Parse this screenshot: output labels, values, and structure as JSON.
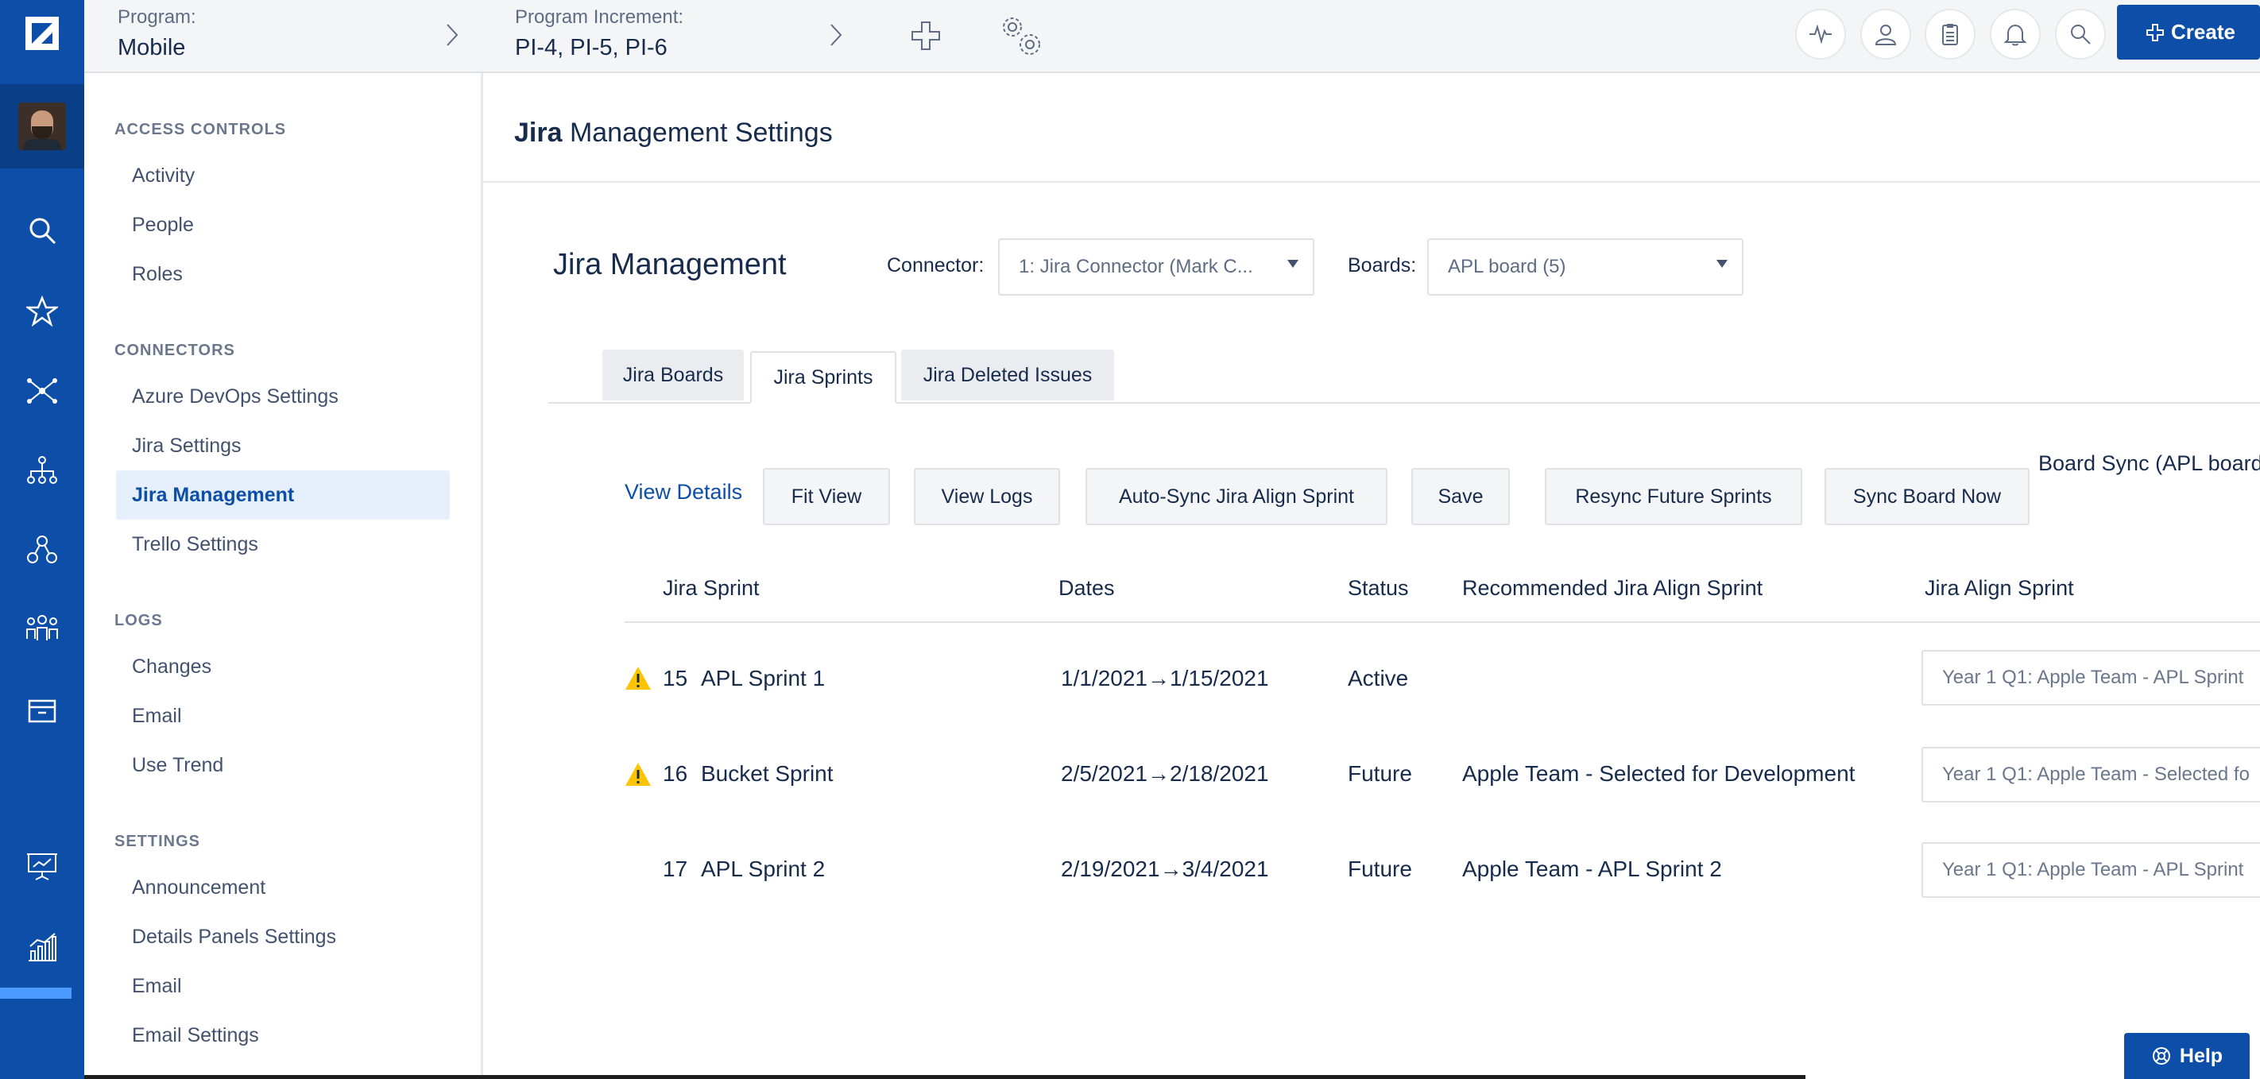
{
  "topbar": {
    "program_label": "Program:",
    "program_value": "Mobile",
    "increment_label": "Program Increment:",
    "increment_value": "PI-4, PI-5, PI-6",
    "create_label": "Create"
  },
  "sidebar": {
    "sections": [
      {
        "title": "ACCESS CONTROLS",
        "items": [
          "Activity",
          "People",
          "Roles"
        ]
      },
      {
        "title": "CONNECTORS",
        "items": [
          "Azure DevOps Settings",
          "Jira Settings",
          "Jira Management",
          "Trello Settings"
        ]
      },
      {
        "title": "LOGS",
        "items": [
          "Changes",
          "Email",
          "Use Trend"
        ]
      },
      {
        "title": "SETTINGS",
        "items": [
          "Announcement",
          "Details Panels Settings",
          "Email",
          "Email Settings"
        ]
      }
    ],
    "active_item": "Jira Management"
  },
  "page": {
    "title_bold": "Jira",
    "title_rest": " Management Settings"
  },
  "management": {
    "title": "Jira Management",
    "connector_label": "Connector:",
    "connector_value": "1: Jira Connector (Mark C...",
    "boards_label": "Boards:",
    "boards_value": "APL board (5)"
  },
  "tabs": [
    "Jira Boards",
    "Jira Sprints",
    "Jira Deleted Issues"
  ],
  "active_tab": "Jira Sprints",
  "toolbar": {
    "view_details": "View Details",
    "fit_view": "Fit View",
    "view_logs": "View Logs",
    "auto_sync": "Auto-Sync Jira Align Sprint",
    "save": "Save",
    "resync": "Resync Future Sprints",
    "sync_board": "Sync Board Now",
    "board_sync_label": "Board Sync (APL board"
  },
  "table": {
    "headers": [
      "Jira Sprint",
      "Dates",
      "Status",
      "Recommended Jira Align Sprint",
      "Jira Align Sprint"
    ],
    "rows": [
      {
        "warning": true,
        "id": "15",
        "name": "APL Sprint 1",
        "dates": "1/1/2021→1/15/2021",
        "status": "Active",
        "recommended": "",
        "align_sprint": "Year 1 Q1: Apple Team - APL Sprint"
      },
      {
        "warning": true,
        "id": "16",
        "name": "Bucket Sprint",
        "dates": "2/5/2021→2/18/2021",
        "status": "Future",
        "recommended": "Apple Team - Selected for Development",
        "align_sprint": "Year 1 Q1: Apple Team - Selected fo"
      },
      {
        "warning": false,
        "id": "17",
        "name": "APL Sprint 2",
        "dates": "2/19/2021→3/4/2021",
        "status": "Future",
        "recommended": "Apple Team - APL Sprint 2",
        "align_sprint": "Year 1 Q1: Apple Team - APL Sprint"
      }
    ]
  },
  "help_label": "Help",
  "colors": {
    "brand": "#0d4fa8",
    "warning": "#ffc400",
    "active_bg": "#e6f0fc"
  },
  "icons": [
    "logo-icon",
    "search-icon",
    "star-icon",
    "network-icon",
    "hierarchy-icon",
    "nodes-icon",
    "team-icon",
    "archive-icon",
    "presentation-icon",
    "chart-icon",
    "chevron-right-icon",
    "plus-icon",
    "gears-icon",
    "pulse-icon",
    "user-icon",
    "clipboard-icon",
    "bell-icon",
    "warning-icon",
    "help-icon"
  ]
}
